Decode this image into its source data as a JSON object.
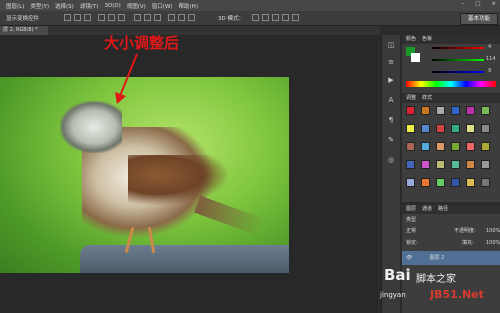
{
  "menubar": {
    "items": [
      "图层(L)",
      "类型(Y)",
      "选择(S)",
      "滤镜(T)",
      "3D(D)",
      "视图(V)",
      "窗口(W)",
      "帮助(H)"
    ]
  },
  "optbar": {
    "label": "显示变换控件",
    "mode": "3D 模式：",
    "workspace": "基本功能"
  },
  "doc": {
    "tab": "层 2, RGB/8) *"
  },
  "annotation": {
    "text": "大小调整后",
    "color": "#e01818"
  },
  "panels": {
    "color_tabs": [
      "颜色",
      "色板"
    ],
    "slider_values": [
      "4",
      "114",
      "9"
    ],
    "style_tabs": [
      "调整",
      "样式"
    ],
    "layer_tabs": [
      "图层",
      "通道",
      "路径"
    ],
    "layer_kind": "类型",
    "blend_mode": "正常",
    "opacity_label": "不透明度:",
    "opacity_value": "100%",
    "lock_label": "锁定:",
    "fill_label": "填充:",
    "fill_value": "100%",
    "layer_name": "图层 2"
  },
  "watermark": {
    "baidu": "Bai",
    "jingyan": "jingyan",
    "site_cn": "脚本之家",
    "site_en": "JB51.Net"
  },
  "colors": {
    "accent_red": "#e01818",
    "fg_swatch": "#1a9a2a",
    "bg_panel": "#3d3d3d"
  }
}
